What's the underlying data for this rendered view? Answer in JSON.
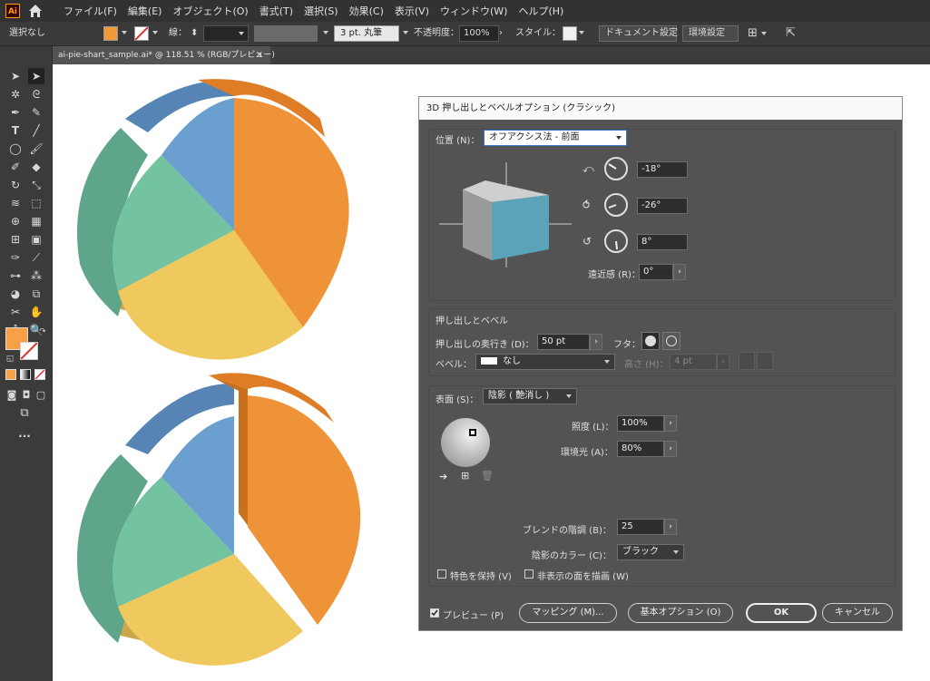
{
  "app": {
    "logo": "Ai",
    "menu": [
      "ファイル(F)",
      "編集(E)",
      "オブジェクト(O)",
      "書式(T)",
      "選択(S)",
      "効果(C)",
      "表示(V)",
      "ウィンドウ(W)",
      "ヘルプ(H)"
    ]
  },
  "control_bar": {
    "selection": "選択なし",
    "fill_color": "#f09a3a",
    "stroke_label": "線：",
    "brush": "3 pt. 丸筆",
    "opacity_label": "不透明度：",
    "opacity": "100%",
    "style_label": "スタイル：",
    "doc_settings": "ドキュメント設定",
    "preferences": "環境設定"
  },
  "document_tab": {
    "title": "ai-pie-shart_sample.ai* @ 118.51 % (RGB/プレビュー)",
    "close": "×"
  },
  "toolbar": {
    "more": "..."
  },
  "colors": {
    "orange": "#ee9338",
    "yellow": "#efc85e",
    "green": "#74c3a0",
    "blue": "#6a9fd0"
  },
  "dialog": {
    "title": "3D 押し出しとベベルオプション (クラシック)",
    "position_label": "位置 (N)：",
    "position_value": "オフアクシス法 - 前面",
    "rot_x": "-18°",
    "rot_y": "-26°",
    "rot_z": "8°",
    "perspective_label": "遠近感 (R)：",
    "perspective_value": "0°",
    "extrude_section": "押し出しとベベル",
    "depth_label": "押し出しの奥行き (D)：",
    "depth_value": "50 pt",
    "cap_label": "フタ：",
    "bevel_label": "ベベル：",
    "bevel_value": "なし",
    "height_label": "高さ (H)：",
    "height_value": "4 pt",
    "surface_label": "表面 (S)：",
    "surface_value": "陰影 ( 艶消し )",
    "light_intensity_label": "照度 (L)：",
    "light_intensity_value": "100%",
    "ambient_label": "環境光 (A)：",
    "ambient_value": "80%",
    "blend_label": "ブレンドの階調 (B)：",
    "blend_value": "25",
    "shade_color_label": "陰影のカラー (C)：",
    "shade_color_value": "ブラック",
    "preserve_spot": "特色を保持 (V)",
    "draw_hidden": "非表示の面を描画 (W)",
    "preview": "プレビュー (P)",
    "mapping": "マッピング (M)...",
    "basic_options": "基本オプション (O)",
    "ok": "OK",
    "cancel": "キャンセル"
  }
}
